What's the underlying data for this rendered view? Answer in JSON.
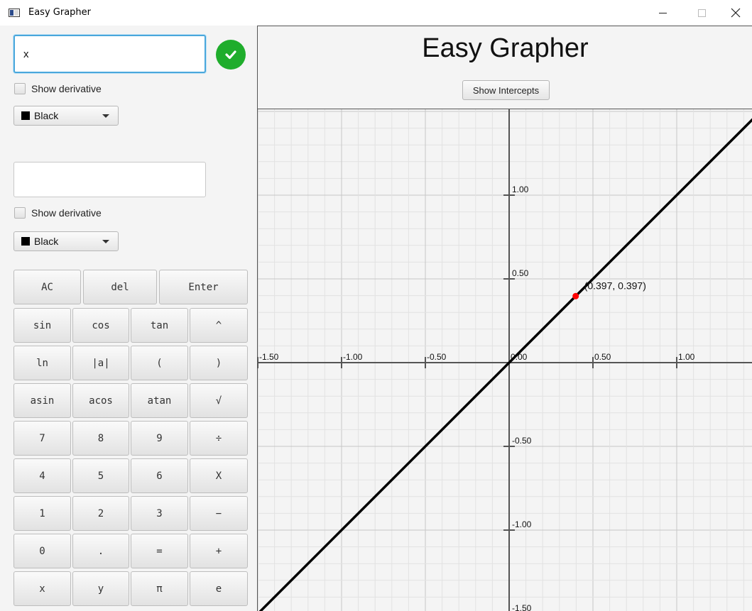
{
  "window": {
    "title": "Easy Grapher"
  },
  "functions": [
    {
      "value": "x",
      "placeholder": "",
      "derivative_label": "Show derivative",
      "color_label": "Black",
      "color": "#000000"
    },
    {
      "value": "",
      "placeholder": "",
      "derivative_label": "Show derivative",
      "color_label": "Black",
      "color": "#000000"
    }
  ],
  "keypad": {
    "rows": [
      [
        "AC",
        "del",
        "Enter"
      ],
      [
        "sin",
        "cos",
        "tan",
        "^"
      ],
      [
        "ln",
        "|a|",
        "(",
        ")"
      ],
      [
        "asin",
        "acos",
        "atan",
        "√"
      ],
      [
        "7",
        "8",
        "9",
        "÷"
      ],
      [
        "4",
        "5",
        "6",
        "X"
      ],
      [
        "1",
        "2",
        "3",
        "−"
      ],
      [
        "0",
        ".",
        "=",
        "+"
      ],
      [
        "x",
        "y",
        "π",
        "e"
      ]
    ]
  },
  "graph": {
    "title": "Easy Grapher",
    "intercepts_button": "Show Intercepts"
  },
  "chart_data": {
    "type": "line",
    "xlim": [
      -1.5,
      1.5
    ],
    "ylim": [
      -1.5,
      1.5
    ],
    "x_ticks": [
      "-1.50",
      "-1.00",
      "-0.50",
      "0.00",
      "0.50",
      "1.00"
    ],
    "y_ticks": [
      "1.00",
      "0.50",
      "-0.50",
      "-1.00",
      "-1.50"
    ],
    "x_tick_values": [
      -1.5,
      -1.0,
      -0.5,
      0.0,
      0.5,
      1.0
    ],
    "y_tick_values": [
      1.0,
      0.5,
      -0.5,
      -1.0,
      -1.5
    ],
    "grid": true,
    "series": [
      {
        "x": [
          -1.5,
          1.5
        ],
        "y": [
          -1.5,
          1.5
        ],
        "color": "#000000"
      }
    ],
    "point": {
      "x": 0.397,
      "y": 0.397,
      "label": "(0.397, 0.397)",
      "color": "#ff0000"
    }
  }
}
